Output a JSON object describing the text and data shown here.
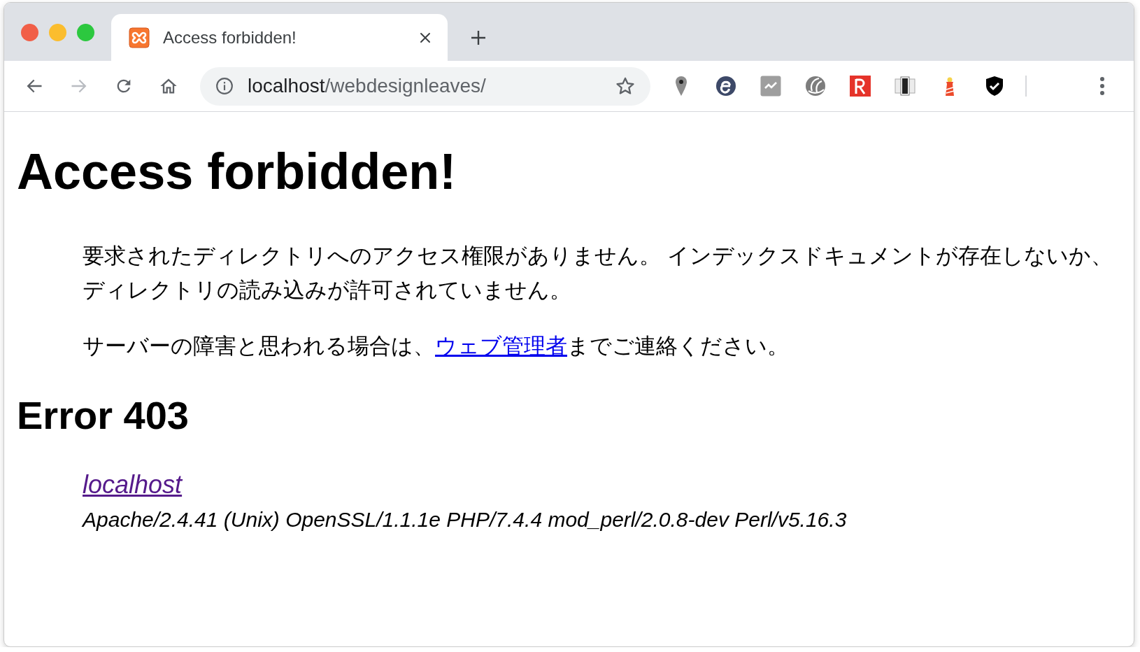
{
  "window": {
    "tabs": [
      {
        "title": "Access forbidden!",
        "selected": true
      }
    ]
  },
  "toolbar": {
    "nav_buttons": [
      {
        "kind": "back",
        "disabled": false
      },
      {
        "kind": "forward",
        "disabled": true
      },
      {
        "kind": "reload",
        "disabled": false
      },
      {
        "kind": "home",
        "disabled": false
      }
    ],
    "address_bar": {
      "host": "localhost",
      "path": "/webdesignleaves/"
    }
  },
  "page": {
    "heading": "Access forbidden!",
    "message": "要求されたディレクトリへのアクセス権限がありません。 インデックスドキュメントが存在しないか、ディレクトリの読み込みが許可されていません。",
    "contact": {
      "before": "サーバーの障害と思われる場合は、",
      "link": "ウェブ管理者",
      "after": "までご連絡ください。"
    },
    "error_heading": "Error 403",
    "address": {
      "link": "localhost",
      "visited": true,
      "server": "Apache/2.4.41 (Unix) OpenSSL/1.1.1e PHP/7.4.4 mod_perl/2.0.8-dev Perl/v5.16.3"
    }
  }
}
